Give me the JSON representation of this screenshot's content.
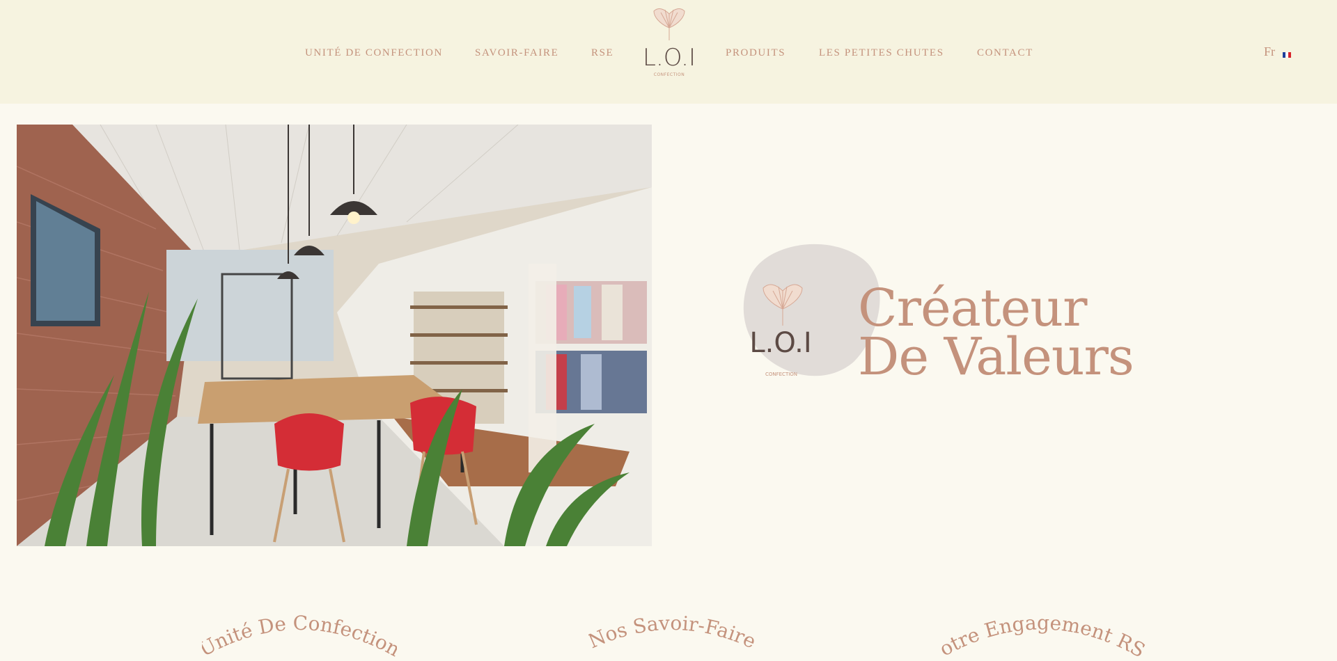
{
  "nav": {
    "left": [
      "UNITÉ DE CONFECTION",
      "SAVOIR-FAIRE",
      "RSE"
    ],
    "right": [
      "PRODUITS",
      "LES PETITES CHUTES",
      "CONTACT"
    ],
    "lang": "Fr"
  },
  "logo": {
    "mark": "L.O.I",
    "sub": "CONFECTION"
  },
  "hero": {
    "line1": "Créateur",
    "line2": "De Valeurs"
  },
  "sections": [
    "Unité De Confection",
    "Nos Savoir-Faire",
    "Notre Engagement RSE"
  ],
  "colors": {
    "header_bg": "#f6f3e0",
    "page_bg": "#fbf9f0",
    "accent": "#c4927c",
    "blob": "#e1dcd8"
  },
  "icons": [
    "ginkgo-leaf-logo",
    "french-flag-icon"
  ]
}
